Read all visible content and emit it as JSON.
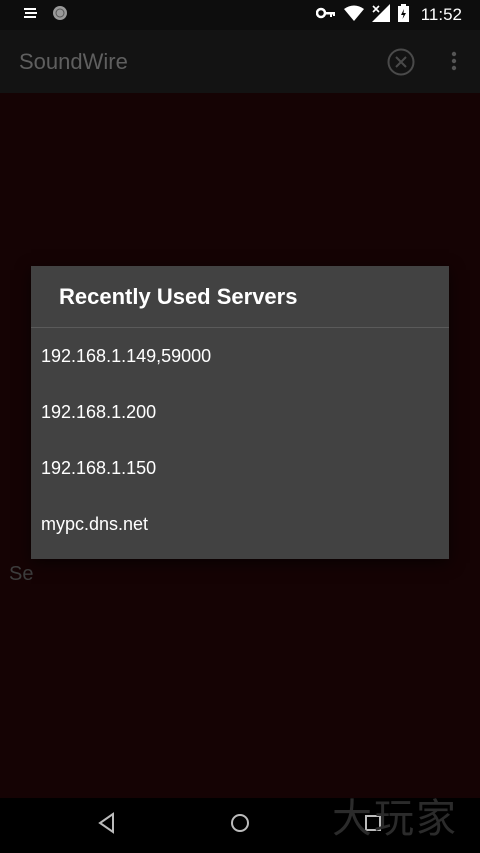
{
  "status_bar": {
    "time": "11:52",
    "icons": [
      "notification-icon",
      "circle-icon",
      "vpn-key-icon",
      "wifi-icon",
      "signal-icon",
      "battery-icon"
    ]
  },
  "app_bar": {
    "title": "SoundWire",
    "actions": [
      "close-circle-icon",
      "overflow-menu-icon"
    ]
  },
  "background": {
    "partial_text": "Se"
  },
  "dialog": {
    "title": "Recently Used Servers",
    "servers": [
      "192.168.1.149,59000",
      "192.168.1.200",
      "192.168.1.150",
      "mypc.dns.net"
    ]
  },
  "nav_bar": {
    "buttons": [
      "back-icon",
      "home-icon",
      "recents-icon"
    ]
  },
  "watermark": "大玩家",
  "colors": {
    "dialog_bg": "#424242",
    "app_bg": "#150304",
    "appbar_bg": "#131313",
    "title_text": "#5f5f5f"
  }
}
